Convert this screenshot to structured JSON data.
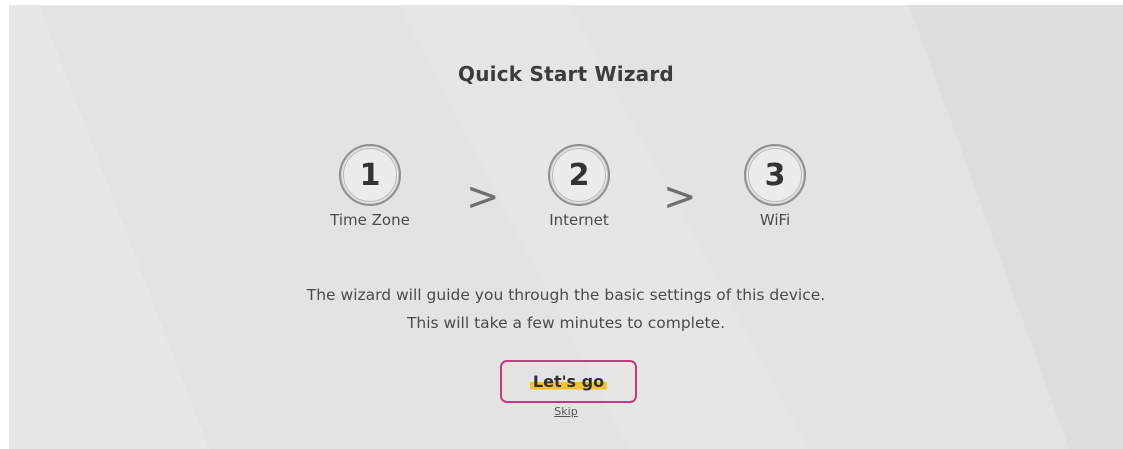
{
  "wizard": {
    "title": "Quick Start Wizard",
    "steps": [
      {
        "number": "1",
        "label": "Time Zone"
      },
      {
        "number": "2",
        "label": "Internet"
      },
      {
        "number": "3",
        "label": "WiFi"
      }
    ],
    "separator": ">",
    "description_line1": "The wizard will guide you through the basic settings of this device.",
    "description_line2": "This will take a few minutes to complete.",
    "start_label": "Let's go",
    "skip_label": "Skip"
  },
  "colors": {
    "background": "#e3e4e2",
    "button_border": "#c8387d",
    "highlight": "#f2c230"
  }
}
